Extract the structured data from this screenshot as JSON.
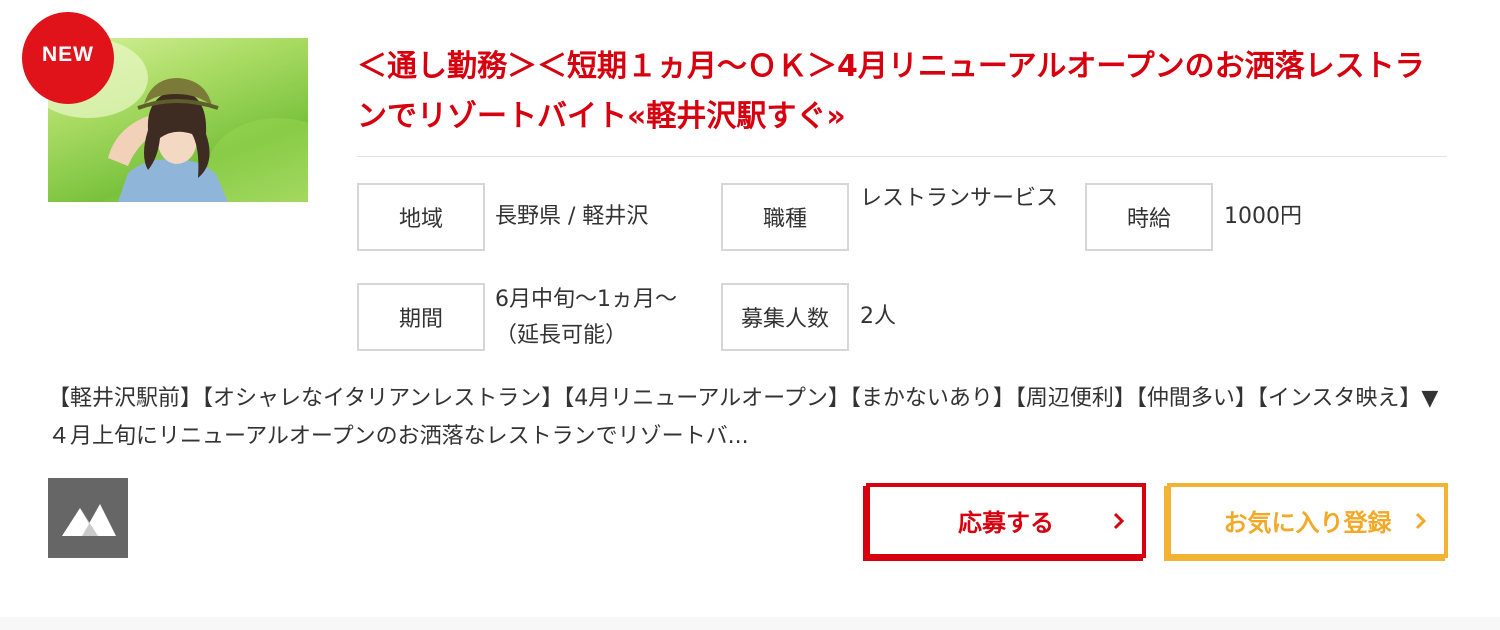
{
  "listing": {
    "badge": "NEW",
    "title": "＜通し勤務＞＜短期１ヵ月〜ＯＫ＞4月リニューアルオープンのお洒落レストランでリゾートバイト«軽井沢駅すぐ»",
    "info": {
      "region": {
        "label": "地域",
        "value": "長野県 / 軽井沢"
      },
      "job_type": {
        "label": "職種",
        "value": "レストランサービス"
      },
      "wage": {
        "label": "時給",
        "value": "1000円"
      },
      "period": {
        "label": "期間",
        "value": "6月中旬〜1ヵ月〜（延長可能）"
      },
      "openings": {
        "label": "募集人数",
        "value": "2人"
      }
    },
    "description": "【軽井沢駅前】【オシャレなイタリアンレストラン】【4月リニューアルオープン】【まかないあり】【周辺便利】【仲間多い】【インスタ映え】▼４月上旬にリニューアルオープンのお洒落なレストランでリゾートバ...",
    "buttons": {
      "apply": "応募する",
      "favorite": "お気に入り登録"
    },
    "icons": {
      "gallery": "mountain-icon",
      "chevron": "chevron-right-icon"
    },
    "colors": {
      "accent_red": "#d7000f",
      "accent_yellow": "#f2b233",
      "badge_red": "#e0131b"
    }
  }
}
